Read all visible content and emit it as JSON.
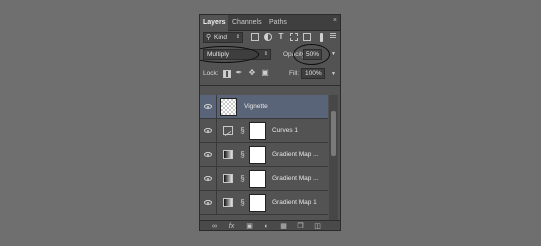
{
  "tabs": [
    {
      "label": "Layers",
      "active": true
    },
    {
      "label": "Channels",
      "active": false
    },
    {
      "label": "Paths",
      "active": false
    }
  ],
  "close_glyph": "×",
  "filter": {
    "kind_label": "Kind",
    "icons": [
      "image-filter-icon",
      "adjustment-filter-icon",
      "type-filter-icon",
      "shape-filter-icon",
      "smart-object-filter-icon"
    ]
  },
  "blend": {
    "mode": "Multiply",
    "opacity_label": "Opacity:",
    "opacity_value": "50%"
  },
  "lock": {
    "label": "Lock:",
    "fill_label": "Fill:",
    "fill_value": "100%"
  },
  "layers": [
    {
      "name": "Vignette",
      "type": "pixel",
      "selected": true
    },
    {
      "name": "Curves 1",
      "type": "curves",
      "selected": false
    },
    {
      "name": "Gradient Map ...",
      "type": "gradient",
      "selected": false
    },
    {
      "name": "Gradient Map ...",
      "type": "gradient",
      "selected": false
    },
    {
      "name": "Gradient Map 1",
      "type": "gradient",
      "selected": false
    }
  ],
  "footer_icons": [
    "link-icon",
    "fx-icon",
    "mask-icon",
    "adjustment-icon",
    "group-icon",
    "new-layer-icon",
    "trash-icon"
  ],
  "footer_fx": "fx",
  "colors": {
    "background": "#6f6f6f",
    "panel": "#535353",
    "selected_row": "#5a6478"
  }
}
